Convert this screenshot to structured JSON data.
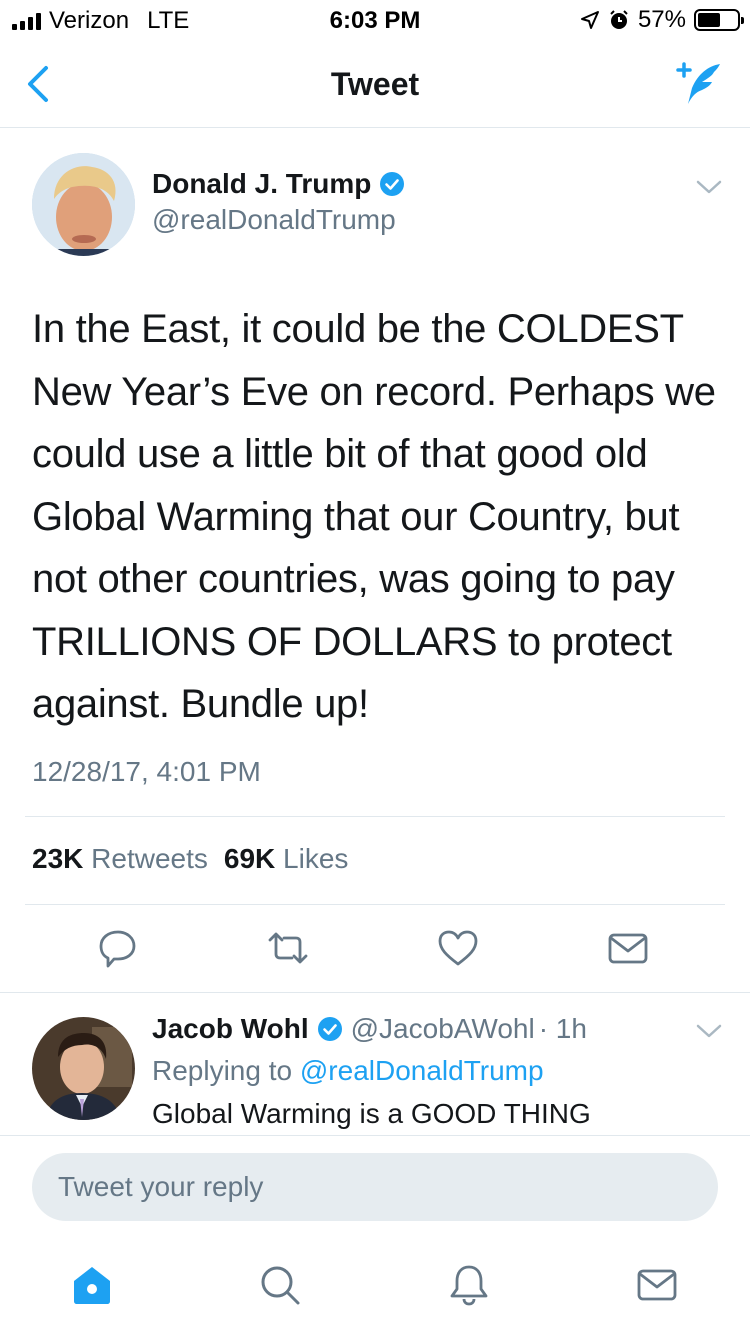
{
  "status_bar": {
    "carrier": "Verizon",
    "network": "LTE",
    "time": "6:03 PM",
    "battery": "57%",
    "battery_level": 0.57,
    "icons": [
      "signal-icon",
      "location-arrow-icon",
      "alarm-icon",
      "battery-icon"
    ]
  },
  "nav": {
    "title": "Tweet",
    "back_icon": "chevron-left-icon",
    "compose_icon": "compose-tweet-icon"
  },
  "tweet": {
    "author_name": "Donald J. Trump",
    "author_handle": "@realDonaldTrump",
    "text": "In the East, it could be the COLDEST New Year’s Eve on record. Perhaps we could use a little bit of that good old Global Warming that our Country, but not other countries, was going to pay TRILLIONS OF DOLLARS to protect against. Bundle up!",
    "timestamp": "12/28/17, 4:01 PM",
    "retweets_count": "23K",
    "retweets_label": "Retweets",
    "likes_count": "69K",
    "likes_label": "Likes"
  },
  "reply": {
    "author_name": "Jacob Wohl",
    "author_handle": "@JacobAWohl",
    "time": "· 1h",
    "replying_prefix": "Replying to",
    "replying_to": "@realDonaldTrump",
    "text": "Global Warming is a GOOD THING"
  },
  "compose": {
    "placeholder": "Tweet your reply"
  },
  "tabs": [
    "home-icon",
    "search-icon",
    "notifications-icon",
    "messages-icon"
  ],
  "colors": {
    "accent": "#1da1f2",
    "secondary_text": "#657786",
    "divider": "#e1e8ed",
    "input_bg": "#e6ecf0"
  }
}
